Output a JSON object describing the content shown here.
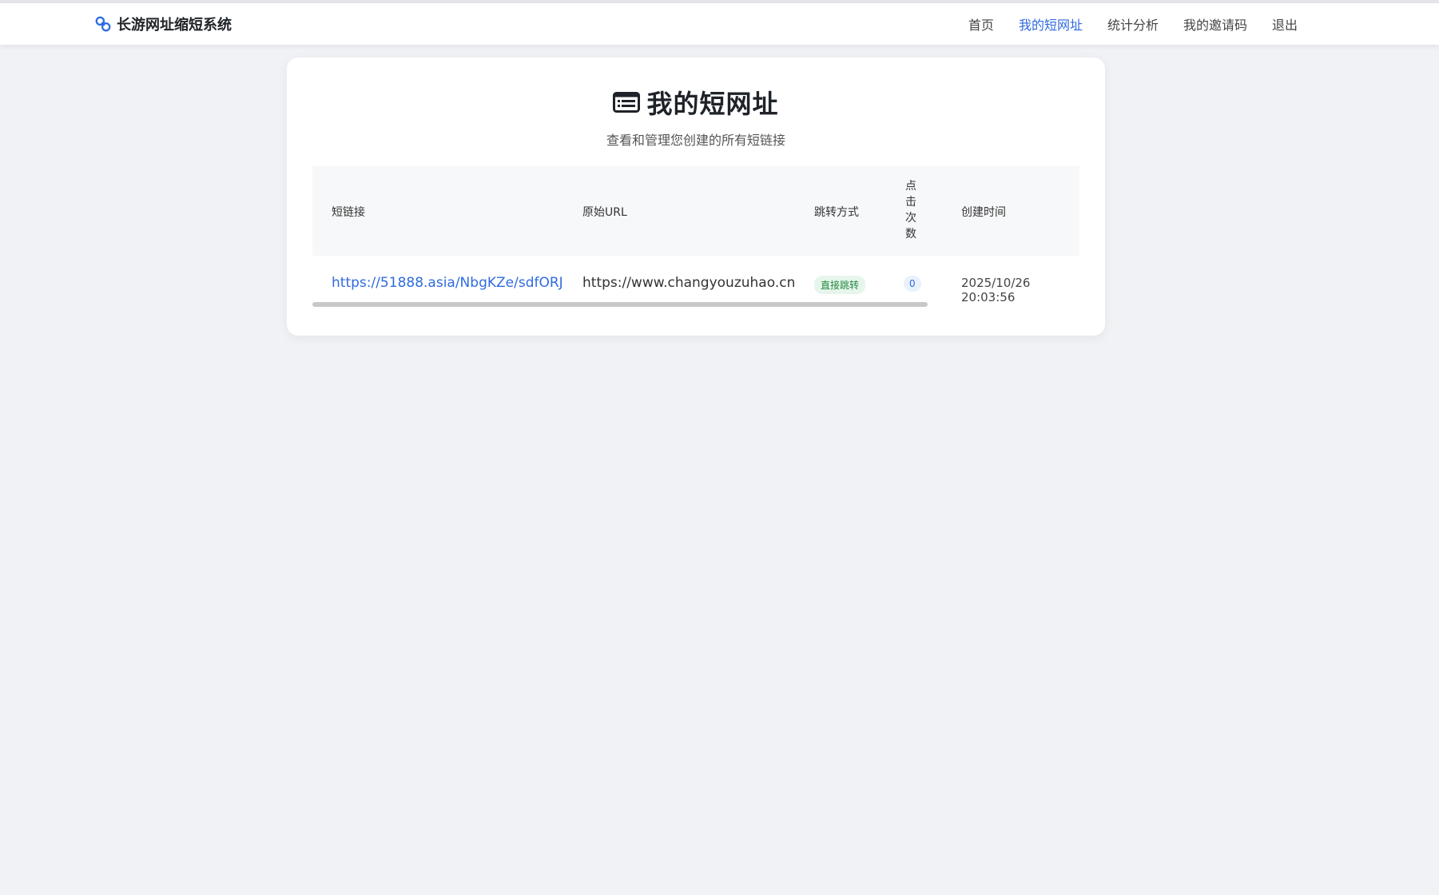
{
  "navbar": {
    "brand_icon": "link-icon",
    "brand": "长游网址缩短系统",
    "links": [
      {
        "label": "首页",
        "active": false
      },
      {
        "label": "我的短网址",
        "active": true
      },
      {
        "label": "统计分析",
        "active": false
      },
      {
        "label": "我的邀请码",
        "active": false
      },
      {
        "label": "退出",
        "active": false
      }
    ]
  },
  "page": {
    "title_icon": "list-icon",
    "title": "我的短网址",
    "subtitle": "查看和管理您创建的所有短链接"
  },
  "table": {
    "headers": {
      "short_link": "短链接",
      "original_url": "原始URL",
      "redirect_mode": "跳转方式",
      "clicks": "点击次数",
      "created_at": "创建时间"
    },
    "rows": [
      {
        "short_link": "https://51888.asia/NbgKZe/sdfORJ",
        "original_url": "https://www.changyouzuhao.cn",
        "redirect_mode": "直接跳转",
        "clicks": "0",
        "created_at": "2025/10/26 20:03:56"
      }
    ]
  },
  "colors": {
    "accent": "#2f6be0",
    "background": "#f0f2f5",
    "badge_green": "#23883f"
  }
}
